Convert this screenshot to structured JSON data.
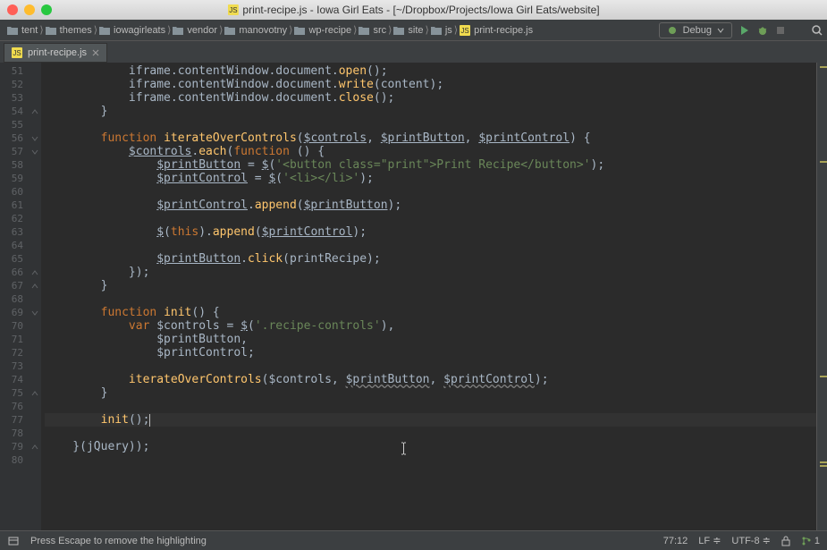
{
  "title": {
    "filename": "print-recipe.js",
    "project": "Iowa Girl Eats",
    "path": "[~/Dropbox/Projects/Iowa Girl Eats/website]"
  },
  "breadcrumbs": [
    {
      "label": "tent",
      "type": "folder"
    },
    {
      "label": "themes",
      "type": "folder"
    },
    {
      "label": "iowagirleats",
      "type": "folder"
    },
    {
      "label": "vendor",
      "type": "folder"
    },
    {
      "label": "manovotny",
      "type": "folder"
    },
    {
      "label": "wp-recipe",
      "type": "folder"
    },
    {
      "label": "src",
      "type": "folder"
    },
    {
      "label": "site",
      "type": "folder"
    },
    {
      "label": "js",
      "type": "folder"
    },
    {
      "label": "print-recipe.js",
      "type": "js"
    }
  ],
  "run_config": "Debug",
  "tab": {
    "label": "print-recipe.js"
  },
  "code_lines": [
    {
      "n": 51,
      "fold": "",
      "tokens": [
        [
          "",
          "            iframe.contentWindow.document."
        ],
        [
          "fn",
          "open"
        ],
        [
          "",
          "();"
        ]
      ]
    },
    {
      "n": 52,
      "fold": "",
      "tokens": [
        [
          "",
          "            iframe.contentWindow.document."
        ],
        [
          "fn",
          "write"
        ],
        [
          "",
          "(content);"
        ]
      ]
    },
    {
      "n": 53,
      "fold": "",
      "tokens": [
        [
          "",
          "            iframe.contentWindow.document."
        ],
        [
          "fn",
          "close"
        ],
        [
          "",
          "();"
        ]
      ]
    },
    {
      "n": 54,
      "fold": "up",
      "tokens": [
        [
          "",
          "        }"
        ]
      ]
    },
    {
      "n": 55,
      "fold": "",
      "tokens": [
        [
          "",
          ""
        ]
      ]
    },
    {
      "n": 56,
      "fold": "down",
      "tokens": [
        [
          "",
          "        "
        ],
        [
          "kw",
          "function"
        ],
        [
          "",
          " "
        ],
        [
          "fn",
          "iterateOverControls"
        ],
        [
          "",
          "("
        ],
        [
          "underline",
          "$controls"
        ],
        [
          "",
          ", "
        ],
        [
          "underline",
          "$printButton"
        ],
        [
          "",
          ", "
        ],
        [
          "underline",
          "$printControl"
        ],
        [
          "",
          ") {"
        ]
      ]
    },
    {
      "n": 57,
      "fold": "down",
      "tokens": [
        [
          "",
          "            "
        ],
        [
          "underline",
          "$controls"
        ],
        [
          "",
          "."
        ],
        [
          "fn",
          "each"
        ],
        [
          "",
          "("
        ],
        [
          "kw",
          "function"
        ],
        [
          "",
          " () {"
        ]
      ]
    },
    {
      "n": 58,
      "fold": "",
      "tokens": [
        [
          "",
          "                "
        ],
        [
          "underline",
          "$printButton"
        ],
        [
          "",
          " = "
        ],
        [
          "underline",
          "$"
        ],
        [
          "",
          "("
        ],
        [
          "str",
          "'<button class=\"print\">Print Recipe</button>'"
        ],
        [
          "",
          ");"
        ]
      ]
    },
    {
      "n": 59,
      "fold": "",
      "tokens": [
        [
          "",
          "                "
        ],
        [
          "underline",
          "$printControl"
        ],
        [
          "",
          " = "
        ],
        [
          "underline",
          "$"
        ],
        [
          "",
          "("
        ],
        [
          "str",
          "'<li></li>'"
        ],
        [
          "",
          ");"
        ]
      ]
    },
    {
      "n": 60,
      "fold": "",
      "tokens": [
        [
          "",
          ""
        ]
      ]
    },
    {
      "n": 61,
      "fold": "",
      "tokens": [
        [
          "",
          "                "
        ],
        [
          "underline",
          "$printControl"
        ],
        [
          "",
          "."
        ],
        [
          "fn",
          "append"
        ],
        [
          "",
          "("
        ],
        [
          "underline",
          "$printButton"
        ],
        [
          "",
          ");"
        ]
      ]
    },
    {
      "n": 62,
      "fold": "",
      "tokens": [
        [
          "",
          ""
        ]
      ]
    },
    {
      "n": 63,
      "fold": "",
      "tokens": [
        [
          "",
          "                "
        ],
        [
          "underline",
          "$"
        ],
        [
          "",
          "("
        ],
        [
          "this",
          "this"
        ],
        [
          "",
          ")."
        ],
        [
          "fn",
          "append"
        ],
        [
          "",
          "("
        ],
        [
          "underline",
          "$printControl"
        ],
        [
          "",
          ");"
        ]
      ]
    },
    {
      "n": 64,
      "fold": "",
      "tokens": [
        [
          "",
          ""
        ]
      ]
    },
    {
      "n": 65,
      "fold": "",
      "tokens": [
        [
          "",
          "                "
        ],
        [
          "underline",
          "$printButton"
        ],
        [
          "",
          "."
        ],
        [
          "fn",
          "click"
        ],
        [
          "",
          "(printRecipe);"
        ]
      ]
    },
    {
      "n": 66,
      "fold": "up",
      "tokens": [
        [
          "",
          "            });"
        ]
      ]
    },
    {
      "n": 67,
      "fold": "up",
      "tokens": [
        [
          "",
          "        }"
        ]
      ]
    },
    {
      "n": 68,
      "fold": "",
      "tokens": [
        [
          "",
          ""
        ]
      ]
    },
    {
      "n": 69,
      "fold": "down",
      "tokens": [
        [
          "",
          "        "
        ],
        [
          "kw",
          "function"
        ],
        [
          "",
          " "
        ],
        [
          "fn",
          "init"
        ],
        [
          "",
          "() {"
        ]
      ]
    },
    {
      "n": 70,
      "fold": "",
      "tokens": [
        [
          "",
          "            "
        ],
        [
          "kw",
          "var"
        ],
        [
          "",
          " $controls = "
        ],
        [
          "underline",
          "$"
        ],
        [
          "",
          "("
        ],
        [
          "str",
          "'.recipe-controls'"
        ],
        [
          "",
          "),"
        ]
      ]
    },
    {
      "n": 71,
      "fold": "",
      "tokens": [
        [
          "",
          "                $printButton,"
        ]
      ]
    },
    {
      "n": 72,
      "fold": "",
      "tokens": [
        [
          "",
          "                $printControl;"
        ]
      ]
    },
    {
      "n": 73,
      "fold": "",
      "tokens": [
        [
          "",
          ""
        ]
      ]
    },
    {
      "n": 74,
      "fold": "",
      "tokens": [
        [
          "",
          "            "
        ],
        [
          "fn",
          "iterateOverControls"
        ],
        [
          "",
          "($controls, "
        ],
        [
          "wavy",
          "$printButton"
        ],
        [
          "",
          ", "
        ],
        [
          "wavy",
          "$printControl"
        ],
        [
          "",
          ");"
        ]
      ]
    },
    {
      "n": 75,
      "fold": "up",
      "tokens": [
        [
          "",
          "        }"
        ]
      ]
    },
    {
      "n": 76,
      "fold": "",
      "tokens": [
        [
          "",
          ""
        ]
      ]
    },
    {
      "n": 77,
      "fold": "",
      "cur": true,
      "tokens": [
        [
          "",
          "        "
        ],
        [
          "fn",
          "init"
        ],
        [
          "",
          "();"
        ]
      ],
      "caret": true
    },
    {
      "n": 78,
      "fold": "",
      "tokens": [
        [
          "",
          ""
        ]
      ]
    },
    {
      "n": 79,
      "fold": "up",
      "tokens": [
        [
          "",
          "    }(jQuery));"
        ]
      ]
    },
    {
      "n": 80,
      "fold": "",
      "tokens": [
        [
          "",
          ""
        ]
      ]
    }
  ],
  "status": {
    "message": "Press Escape to remove the highlighting",
    "position": "77:12",
    "line_sep": "LF",
    "encoding": "UTF-8",
    "git_branch": "1"
  }
}
